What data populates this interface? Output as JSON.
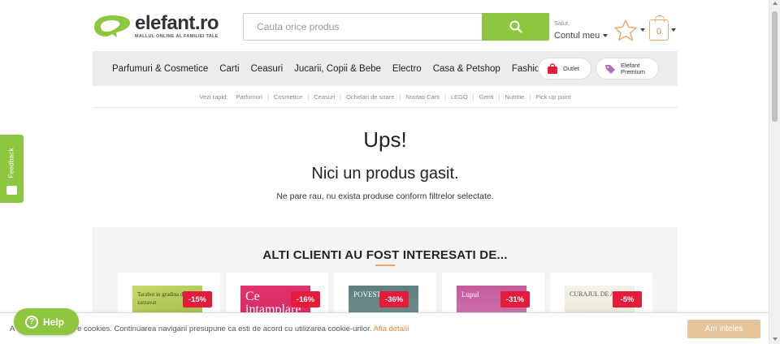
{
  "brand": {
    "name_main": "elefant",
    "name_tld": ".ro",
    "tagline": "MALLUL ONLINE AL FAMILIEI TALE",
    "accent_color": "#8dc63f"
  },
  "search": {
    "placeholder": "Cauta orice produs",
    "button_icon": "search-icon"
  },
  "account": {
    "greeting": "Salut,",
    "link_label": "Contul meu"
  },
  "cart": {
    "count": "0"
  },
  "nav": {
    "items": [
      "Parfumuri & Cosmetice",
      "Carti",
      "Ceasuri",
      "Jucarii, Copii & Bebe",
      "Electro",
      "Casa & Petshop",
      "Fashion"
    ],
    "outlet_label": "Outlet",
    "premium_line1": "Elefant",
    "premium_line2": "Premium"
  },
  "quick_links": {
    "label": "Vezi rapid:",
    "items": [
      "Parfumuri",
      "Cosmetice",
      "Ceasuri",
      "Ochelari de soare",
      "Noutati Carti",
      "LEGO",
      "Genti",
      "Nutritie",
      "Pick-up point"
    ]
  },
  "empty_state": {
    "title": "Ups!",
    "subtitle": "Nici un produs gasit.",
    "message": "Ne pare rau, nu exista produse conform filtrelor selectate."
  },
  "recommendations": {
    "title": "ALTI CLIENTI AU FOST INTERESATI DE...",
    "products": [
      {
        "discount": "-15%",
        "cover_text": "Tarabot in gradina de zarzavat"
      },
      {
        "discount": "-16%",
        "cover_text": "Ce intamplare"
      },
      {
        "discount": "-36%",
        "cover_text": "POVESTEA ME"
      },
      {
        "discount": "-31%",
        "cover_text": "Lupul"
      },
      {
        "discount": "-5%",
        "cover_text": "CURAJUL DE A NU FI"
      }
    ]
  },
  "feedback": {
    "label": "Feedback"
  },
  "cookie": {
    "text_prefix": "A",
    "text": "e cookies. Continuarea navigarii presupune ca esti de acord cu utilizarea cookie-urilor.",
    "link": "Afla detalii",
    "accept_label": "Am inteles"
  },
  "help": {
    "label": "Help"
  }
}
